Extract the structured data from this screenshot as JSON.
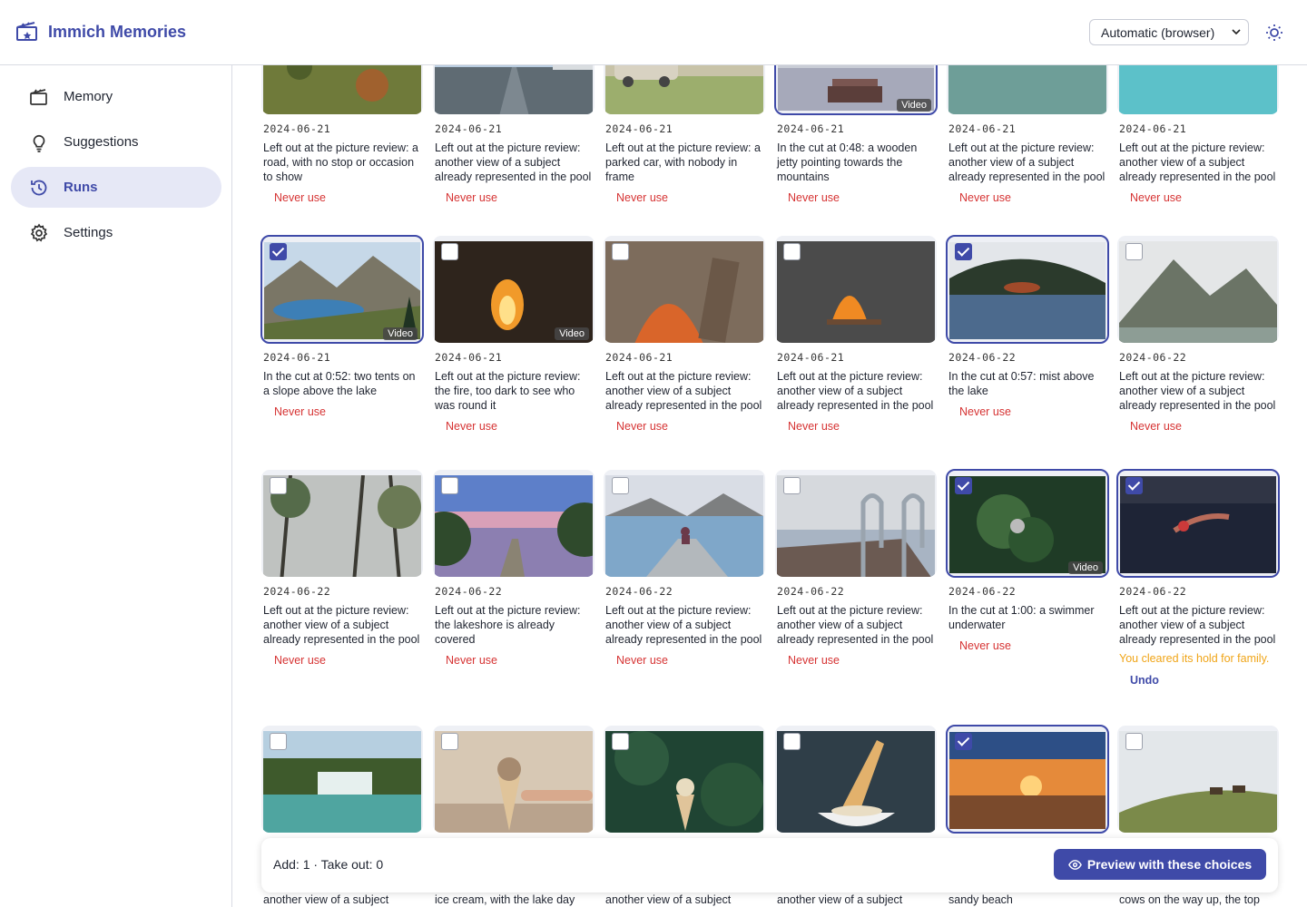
{
  "app": {
    "title": "Immich Memories"
  },
  "theme_select": {
    "value": "Automatic (browser)"
  },
  "sidebar": {
    "items": [
      {
        "label": "Memory",
        "icon": "film-star-icon"
      },
      {
        "label": "Suggestions",
        "icon": "lightbulb-icon"
      },
      {
        "label": "Runs",
        "icon": "history-icon"
      },
      {
        "label": "Settings",
        "icon": "gear-icon"
      }
    ]
  },
  "clips": [
    {
      "date": "2024-06-21",
      "desc": "Left out at the picture review: a road, with no stop or occasion to show",
      "action": "Never use",
      "selected": false,
      "video": false,
      "scene": "hillside"
    },
    {
      "date": "2024-06-21",
      "desc": "Left out at the picture review: another view of a subject already represented in the pool",
      "action": "Never use",
      "selected": false,
      "video": false,
      "scene": "road"
    },
    {
      "date": "2024-06-21",
      "desc": "Left out at the picture review: a parked car, with nobody in frame",
      "action": "Never use",
      "selected": false,
      "video": false,
      "scene": "car"
    },
    {
      "date": "2024-06-21",
      "desc": "In the cut at 0:48: a wooden jetty pointing towards the mountains",
      "action": "Never use",
      "selected": true,
      "video": true,
      "scene": "jetty"
    },
    {
      "date": "2024-06-21",
      "desc": "Left out at the picture review: another view of a subject already represented in the pool",
      "action": "Never use",
      "selected": false,
      "video": false,
      "scene": "island"
    },
    {
      "date": "2024-06-21",
      "desc": "Left out at the picture review: another view of a subject already represented in the pool",
      "action": "Never use",
      "selected": false,
      "video": false,
      "scene": "boat"
    },
    {
      "date": "2024-06-21",
      "desc": "In the cut at 0:52: two tents on a slope above the lake",
      "action": "Never use",
      "selected": true,
      "video": true,
      "scene": "mountain-lake"
    },
    {
      "date": "2024-06-21",
      "desc": "Left out at the picture review: the fire, too dark to see who was round it",
      "action": "Never use",
      "selected": false,
      "video": true,
      "scene": "fire-dark"
    },
    {
      "date": "2024-06-21",
      "desc": "Left out at the picture review: another view of a subject already represented in the pool",
      "action": "Never use",
      "selected": false,
      "video": false,
      "scene": "fire-close"
    },
    {
      "date": "2024-06-21",
      "desc": "Left out at the picture review: another view of a subject already represented in the pool",
      "action": "Never use",
      "selected": false,
      "video": false,
      "scene": "fire-grey"
    },
    {
      "date": "2024-06-22",
      "desc": "In the cut at 0:57: mist above the lake",
      "action": "Never use",
      "selected": true,
      "video": false,
      "scene": "mist-lake"
    },
    {
      "date": "2024-06-22",
      "desc": "Left out at the picture review: another view of a subject already represented in the pool",
      "action": "Never use",
      "selected": false,
      "video": false,
      "scene": "misty-mountain"
    },
    {
      "date": "2024-06-22",
      "desc": "Left out at the picture review: another view of a subject already represented in the pool",
      "action": "Never use",
      "selected": false,
      "video": false,
      "scene": "trees"
    },
    {
      "date": "2024-06-22",
      "desc": "Left out at the picture review: the lakeshore is already covered",
      "action": "Never use",
      "selected": false,
      "video": false,
      "scene": "sunset-dock"
    },
    {
      "date": "2024-06-22",
      "desc": "Left out at the picture review: another view of a subject already represented in the pool",
      "action": "Never use",
      "selected": false,
      "video": false,
      "scene": "pier-person"
    },
    {
      "date": "2024-06-22",
      "desc": "Left out at the picture review: another view of a subject already represented in the pool",
      "action": "Never use",
      "selected": false,
      "video": false,
      "scene": "ladder"
    },
    {
      "date": "2024-06-22",
      "desc": "In the cut at 1:00: a swimmer underwater",
      "action": "Never use",
      "selected": true,
      "video": true,
      "scene": "underwater"
    },
    {
      "date": "2024-06-22",
      "desc": "Left out at the picture review: another view of a subject already represented in the pool",
      "action": "",
      "note": "You cleared its hold for family.",
      "undo": "Undo",
      "selected": true,
      "video": false,
      "scene": "swimmer"
    },
    {
      "date": "",
      "desc": "another view of a subject already represented in the pool",
      "action": "",
      "selected": false,
      "video": false,
      "scene": "waterfall"
    },
    {
      "date": "",
      "desc": "ice cream, with the lake day already covered",
      "action": "",
      "selected": false,
      "video": false,
      "scene": "icecream-hand"
    },
    {
      "date": "",
      "desc": "another view of a subject already represented in the pool",
      "action": "",
      "selected": false,
      "video": false,
      "scene": "icecream-green"
    },
    {
      "date": "",
      "desc": "another view of a subject already represented in the pool",
      "action": "",
      "selected": false,
      "video": false,
      "scene": "icecream-bowl"
    },
    {
      "date": "",
      "desc": "sandy beach",
      "action": "",
      "selected": true,
      "video": false,
      "scene": "beach-sunset"
    },
    {
      "date": "",
      "desc": "cows on the way up, the top says it better",
      "action": "",
      "selected": false,
      "video": false,
      "scene": "cows"
    }
  ],
  "video_label": "Video",
  "footer": {
    "counts": "Add: 1 · Take out: 0",
    "preview_label": "Preview with these choices"
  },
  "colors": {
    "accent": "#3f4aa8",
    "danger": "#d63333",
    "warning": "#f0a518"
  }
}
